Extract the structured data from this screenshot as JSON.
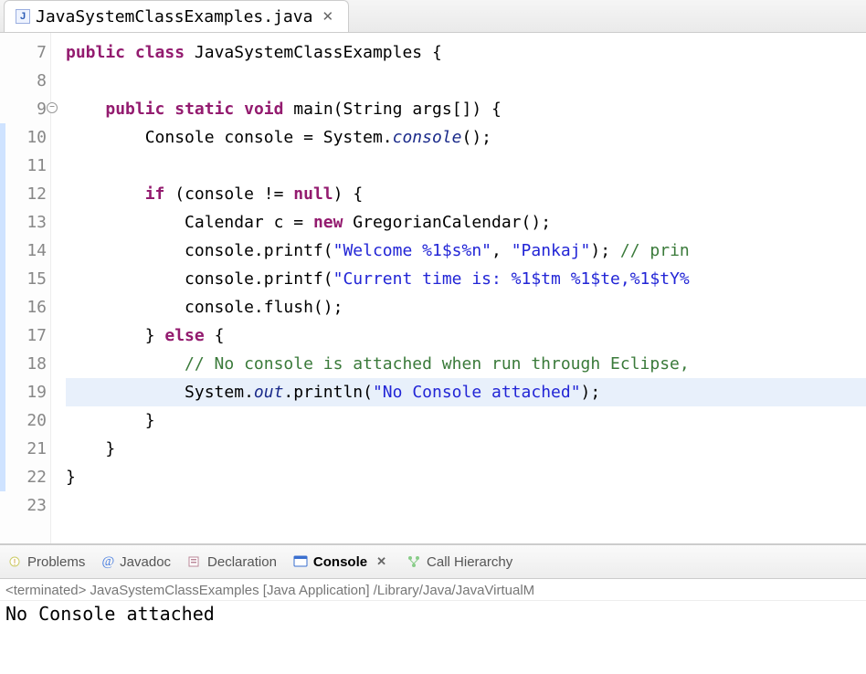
{
  "editorTab": {
    "filename": "JavaSystemClassExamples.java",
    "iconLetter": "J"
  },
  "code": {
    "startLine": 7,
    "lines": [
      {
        "num": 7,
        "cov": false,
        "hl": false,
        "tokens": [
          {
            "t": "public",
            "c": "kw"
          },
          {
            "t": " "
          },
          {
            "t": "class",
            "c": "kw"
          },
          {
            "t": " JavaSystemClassExamples {"
          }
        ]
      },
      {
        "num": 8,
        "cov": false,
        "hl": false,
        "tokens": []
      },
      {
        "num": 9,
        "cov": true,
        "hl": false,
        "fold": true,
        "tokens": [
          {
            "t": "    "
          },
          {
            "t": "public",
            "c": "kw"
          },
          {
            "t": " "
          },
          {
            "t": "static",
            "c": "kw"
          },
          {
            "t": " "
          },
          {
            "t": "void",
            "c": "kw"
          },
          {
            "t": " main(String args[]) {"
          }
        ]
      },
      {
        "num": 10,
        "cov": true,
        "hl": false,
        "tokens": [
          {
            "t": "        Console console = System."
          },
          {
            "t": "console",
            "c": "stat-it"
          },
          {
            "t": "();"
          }
        ]
      },
      {
        "num": 11,
        "cov": true,
        "hl": false,
        "tokens": []
      },
      {
        "num": 12,
        "cov": true,
        "hl": false,
        "tokens": [
          {
            "t": "        "
          },
          {
            "t": "if",
            "c": "kw"
          },
          {
            "t": " (console != "
          },
          {
            "t": "null",
            "c": "kw"
          },
          {
            "t": ") {"
          }
        ]
      },
      {
        "num": 13,
        "cov": true,
        "hl": false,
        "tokens": [
          {
            "t": "            Calendar c = "
          },
          {
            "t": "new",
            "c": "kw"
          },
          {
            "t": " GregorianCalendar();"
          }
        ]
      },
      {
        "num": 14,
        "cov": true,
        "hl": false,
        "tokens": [
          {
            "t": "            console.printf("
          },
          {
            "t": "\"Welcome %1$s%n\"",
            "c": "str"
          },
          {
            "t": ", "
          },
          {
            "t": "\"Pankaj\"",
            "c": "str"
          },
          {
            "t": "); "
          },
          {
            "t": "// prin",
            "c": "com"
          }
        ]
      },
      {
        "num": 15,
        "cov": true,
        "hl": false,
        "tokens": [
          {
            "t": "            console.printf("
          },
          {
            "t": "\"Current time is: %1$tm %1$te,%1$tY%",
            "c": "str"
          }
        ]
      },
      {
        "num": 16,
        "cov": true,
        "hl": false,
        "tokens": [
          {
            "t": "            console.flush();"
          }
        ]
      },
      {
        "num": 17,
        "cov": true,
        "hl": false,
        "tokens": [
          {
            "t": "        } "
          },
          {
            "t": "else",
            "c": "kw"
          },
          {
            "t": " {"
          }
        ]
      },
      {
        "num": 18,
        "cov": true,
        "hl": false,
        "tokens": [
          {
            "t": "            "
          },
          {
            "t": "// No console is attached when run through Eclipse,",
            "c": "com"
          }
        ]
      },
      {
        "num": 19,
        "cov": true,
        "hl": true,
        "tokens": [
          {
            "t": "            System."
          },
          {
            "t": "out",
            "c": "stat-it"
          },
          {
            "t": ".println("
          },
          {
            "t": "\"No Console attached\"",
            "c": "str"
          },
          {
            "t": ");"
          }
        ]
      },
      {
        "num": 20,
        "cov": true,
        "hl": false,
        "tokens": [
          {
            "t": "        }"
          }
        ]
      },
      {
        "num": 21,
        "cov": true,
        "hl": false,
        "tokens": [
          {
            "t": "    }"
          }
        ]
      },
      {
        "num": 22,
        "cov": false,
        "hl": false,
        "tokens": [
          {
            "t": "}"
          }
        ]
      },
      {
        "num": 23,
        "cov": false,
        "hl": false,
        "tokens": []
      }
    ]
  },
  "bottomTabs": {
    "problems": "Problems",
    "javadoc": "Javadoc",
    "declaration": "Declaration",
    "console": "Console",
    "callHierarchy": "Call Hierarchy",
    "javadocAt": "@"
  },
  "console": {
    "statusLine": "<terminated> JavaSystemClassExamples [Java Application] /Library/Java/JavaVirtualM",
    "output": "No Console attached"
  }
}
